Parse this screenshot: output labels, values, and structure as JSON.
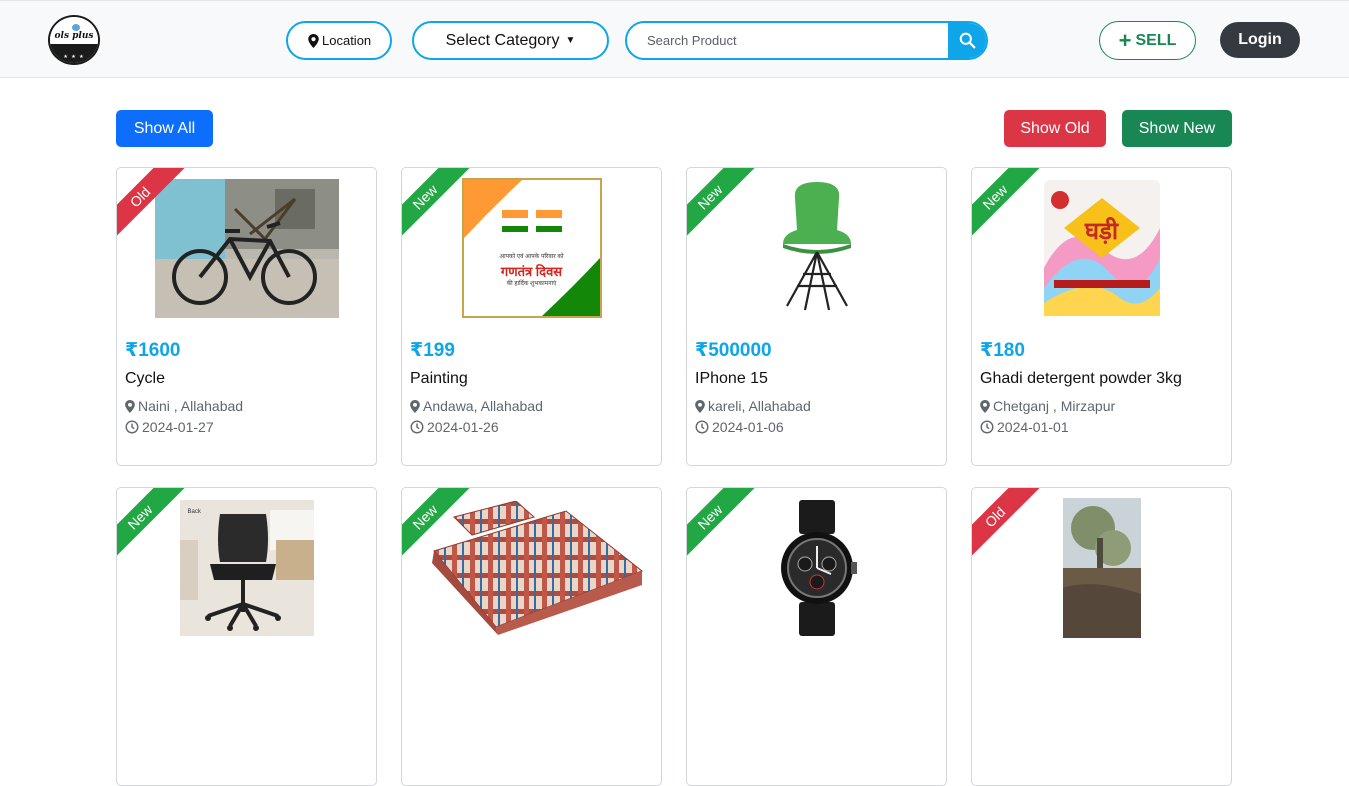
{
  "header": {
    "logo_text": "ols plus",
    "location_label": "Location",
    "category_label": "Select Category",
    "search_placeholder": "Search Product",
    "sell_label": "SELL",
    "login_label": "Login"
  },
  "filters": {
    "show_all": "Show All",
    "show_old": "Show Old",
    "show_new": "Show New"
  },
  "colors": {
    "accent": "#0ea5e9",
    "primary": "#0d6efd",
    "danger": "#dc3545",
    "success": "#198754",
    "dark": "#343a40"
  },
  "products": [
    {
      "badge": "Old",
      "price": "₹1600",
      "title": "Cycle",
      "location": "Naini , Allahabad",
      "date": "2024-01-27",
      "image": "bicycle"
    },
    {
      "badge": "New",
      "price": "₹199",
      "title": "Painting",
      "location": "Andawa, Allahabad",
      "date": "2024-01-26",
      "image": "republic-day-painting"
    },
    {
      "badge": "New",
      "price": "₹500000",
      "title": "IPhone 15",
      "location": "kareli, Allahabad",
      "date": "2024-01-06",
      "image": "green-chair"
    },
    {
      "badge": "New",
      "price": "₹180",
      "title": "Ghadi detergent powder 3kg",
      "location": "Chetganj , Mirzapur",
      "date": "2024-01-01",
      "image": "detergent-pack"
    },
    {
      "badge": "New",
      "image": "office-chair"
    },
    {
      "badge": "New",
      "image": "mattress"
    },
    {
      "badge": "New",
      "image": "wrist-watch"
    },
    {
      "badge": "Old",
      "image": "tree-photo"
    }
  ],
  "image_texts": {
    "painting_line1": "आपको एवं आपके परिवार को",
    "painting_line2": "गणतंत्र दिवस",
    "painting_line3": "की हार्दिक शुभकामनाएं",
    "detergent_brand": "घड़ी",
    "office_chair_tag": "Back"
  }
}
